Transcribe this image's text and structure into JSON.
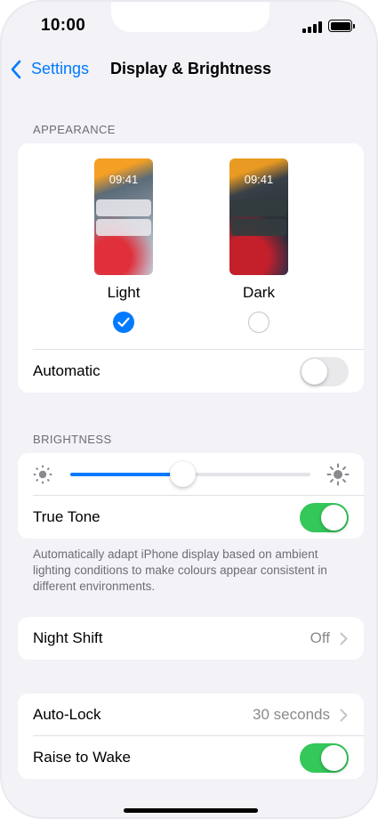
{
  "status_bar": {
    "time": "10:00"
  },
  "nav": {
    "back_label": "Settings",
    "title": "Display & Brightness"
  },
  "appearance": {
    "header": "APPEARANCE",
    "options": [
      {
        "label": "Light",
        "preview_time": "09:41",
        "selected": true
      },
      {
        "label": "Dark",
        "preview_time": "09:41",
        "selected": false
      }
    ],
    "automatic_label": "Automatic",
    "automatic_on": false
  },
  "brightness": {
    "header": "BRIGHTNESS",
    "level": 0.47,
    "true_tone_label": "True Tone",
    "true_tone_on": true,
    "footer": "Automatically adapt iPhone display based on ambient lighting conditions to make colours appear consistent in different environments."
  },
  "night_shift": {
    "label": "Night Shift",
    "value": "Off"
  },
  "lock": {
    "auto_lock_label": "Auto-Lock",
    "auto_lock_value": "30 seconds",
    "raise_to_wake_label": "Raise to Wake",
    "raise_to_wake_on": true
  },
  "colors": {
    "accent": "#007aff",
    "toggle_on": "#34c759",
    "toggle_off": "#e9e9eb",
    "background": "#f2f2f7"
  }
}
